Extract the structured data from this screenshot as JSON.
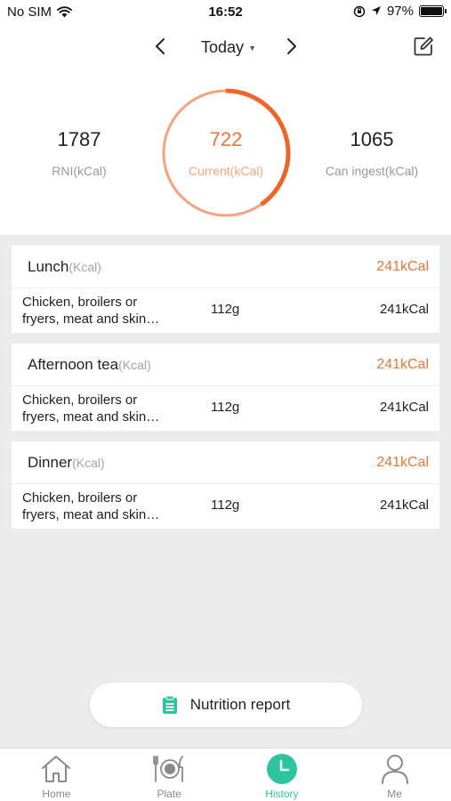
{
  "status_bar": {
    "carrier": "No SIM",
    "time": "16:52",
    "battery": "97%"
  },
  "header": {
    "date_label": "Today"
  },
  "summary": {
    "rni_value": "1787",
    "rni_label": "RNI(kCal)",
    "current_value": "722",
    "current_label": "Current(kCal)",
    "can_ingest_value": "1065",
    "can_ingest_label": "Can ingest(kCal)",
    "progress_fraction": 0.404
  },
  "meals": [
    {
      "name": "Lunch",
      "unit": "(Kcal)",
      "total": "241kCal",
      "items": [
        {
          "name_line1": "Chicken, broilers or",
          "name_line2": "fryers, meat and skin…",
          "weight": "112g",
          "calories": "241kCal"
        }
      ]
    },
    {
      "name": "Afternoon tea",
      "unit": "(Kcal)",
      "total": "241kCal",
      "items": [
        {
          "name_line1": "Chicken, broilers or",
          "name_line2": "fryers, meat and skin…",
          "weight": "112g",
          "calories": "241kCal"
        }
      ]
    },
    {
      "name": "Dinner",
      "unit": "(Kcal)",
      "total": "241kCal",
      "items": [
        {
          "name_line1": "Chicken, broilers or",
          "name_line2": "fryers, meat and skin…",
          "weight": "112g",
          "calories": "241kCal"
        }
      ]
    }
  ],
  "report_button": {
    "label": "Nutrition report"
  },
  "tabs": [
    {
      "label": "Home",
      "icon": "home-icon"
    },
    {
      "label": "Plate",
      "icon": "plate-icon"
    },
    {
      "label": "History",
      "icon": "clock-icon",
      "active": true
    },
    {
      "label": "Me",
      "icon": "person-icon"
    }
  ],
  "colors": {
    "accent": "#f07436",
    "accent_light": "#f3a47e",
    "active_tab": "#2ec4a0",
    "background": "#ececec"
  }
}
